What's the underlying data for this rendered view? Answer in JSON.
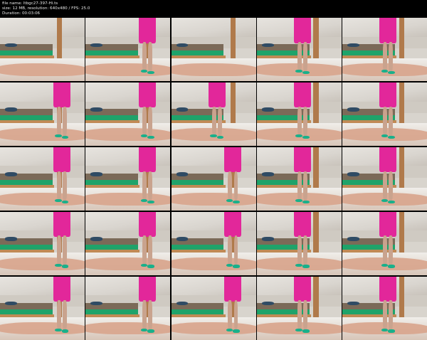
{
  "header": {
    "file_name": "file name: ltbgc27-397-Hi.ts",
    "info": "size: 12 MB, resolution: 640x480 / FPS: 25.0",
    "duration": "Duration: 00:03:06"
  },
  "thumbnails": [
    {
      "figure": false
    },
    {
      "figure": true,
      "pos": "left"
    },
    {
      "figure": false
    },
    {
      "figure": true,
      "pos": "mid"
    },
    {
      "figure": true,
      "pos": "mid"
    },
    {
      "figure": true,
      "pos": "left"
    },
    {
      "figure": true,
      "pos": "left"
    },
    {
      "figure": true,
      "pos": "mid"
    },
    {
      "figure": true,
      "pos": "mid"
    },
    {
      "figure": true,
      "pos": "mid"
    },
    {
      "figure": true,
      "pos": "left"
    },
    {
      "figure": true,
      "pos": "left"
    },
    {
      "figure": true,
      "pos": "left"
    },
    {
      "figure": true,
      "pos": "mid"
    },
    {
      "figure": true,
      "pos": "mid"
    },
    {
      "figure": true,
      "pos": "left"
    },
    {
      "figure": true,
      "pos": "left"
    },
    {
      "figure": true,
      "pos": "left"
    },
    {
      "figure": true,
      "pos": "mid"
    },
    {
      "figure": true,
      "pos": "mid"
    },
    {
      "figure": true,
      "pos": "left"
    },
    {
      "figure": true,
      "pos": "left"
    },
    {
      "figure": true,
      "pos": "left"
    },
    {
      "figure": true,
      "pos": "mid"
    },
    {
      "figure": true,
      "pos": "mid"
    }
  ],
  "colors": {
    "dress": "#e2279a",
    "shoes": "#19b08a",
    "bed_mattress": "#1fa36a",
    "background": "#000000"
  }
}
